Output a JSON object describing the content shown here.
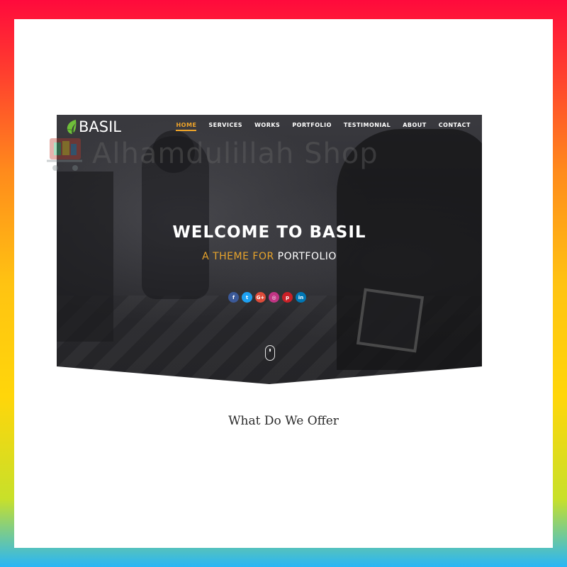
{
  "brand": {
    "logo_text": "BASIL",
    "logo_icon": "leaf-icon",
    "accent_color": "#f0a529"
  },
  "nav": {
    "items": [
      {
        "label": "HOME",
        "active": true
      },
      {
        "label": "SERVICES"
      },
      {
        "label": "WORKS"
      },
      {
        "label": "PORTFOLIO"
      },
      {
        "label": "TESTIMONIAL"
      },
      {
        "label": "ABOUT"
      },
      {
        "label": "CONTACT"
      }
    ]
  },
  "hero": {
    "headline": "WELCOME TO BASIL",
    "sub_accent": "A THEME FOR",
    "sub_white": "PORTFOLIO",
    "scroll_icon": "mouse-scroll-icon",
    "social": [
      {
        "icon": "facebook-icon",
        "glyph": "f",
        "color": "#3b5998"
      },
      {
        "icon": "twitter-icon",
        "glyph": "t",
        "color": "#1da1f2"
      },
      {
        "icon": "google-plus-icon",
        "glyph": "G+",
        "color": "#dd4b39"
      },
      {
        "icon": "instagram-icon",
        "glyph": "◎",
        "color": "#c13584"
      },
      {
        "icon": "pinterest-icon",
        "glyph": "p",
        "color": "#cb2027"
      },
      {
        "icon": "linkedin-icon",
        "glyph": "in",
        "color": "#0077b5"
      }
    ]
  },
  "watermark": {
    "text": "Alhamdulillah Shop"
  },
  "section": {
    "title": "What Do We Offer"
  },
  "colors": {
    "frame_top": "#ff0a3c",
    "frame_bottom": "#29b6f6",
    "hero_bg": "#2b2b30"
  }
}
